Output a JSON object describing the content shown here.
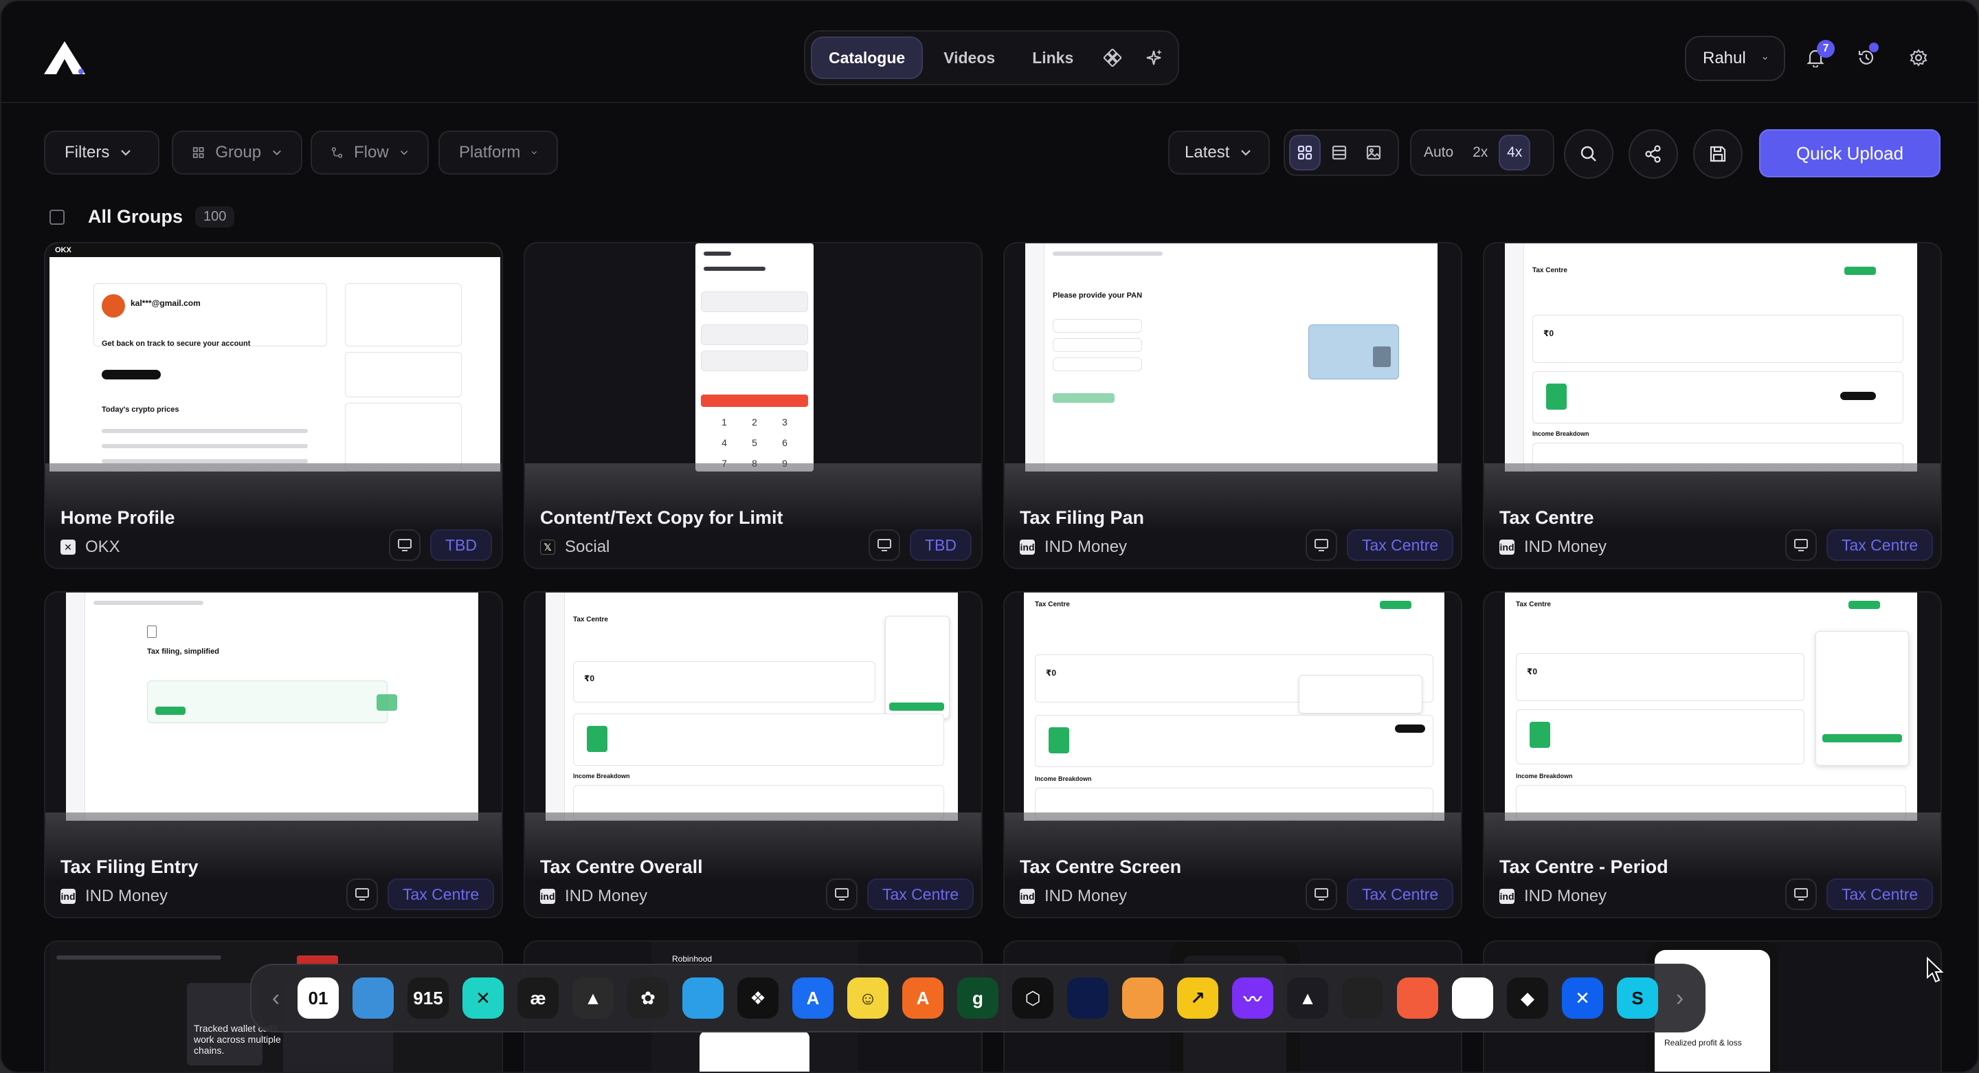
{
  "header": {
    "tabs": [
      {
        "label": "Catalogue",
        "active": true
      },
      {
        "label": "Videos",
        "active": false
      },
      {
        "label": "Links",
        "active": false
      }
    ],
    "user_name": "Rahul",
    "notification_count": "7"
  },
  "toolbar": {
    "filters_label": "Filters",
    "group_label": "Group",
    "flow_label": "Flow",
    "platform_label": "Platform",
    "sort_label": "Latest",
    "scale_options": [
      "Auto",
      "2x",
      "4x"
    ],
    "scale_selected": "4x",
    "quick_upload_label": "Quick Upload"
  },
  "groups": {
    "label": "All Groups",
    "count": "100"
  },
  "cards": [
    {
      "title": "Home Profile",
      "app": "OKX",
      "tag": "TBD"
    },
    {
      "title": "Content/Text Copy for Limit",
      "app": "Social",
      "tag": "TBD"
    },
    {
      "title": "Tax Filing Pan",
      "app": "IND Money",
      "tag": "Tax Centre"
    },
    {
      "title": "Tax Centre",
      "app": "IND Money",
      "tag": "Tax Centre"
    },
    {
      "title": "Tax Filing Entry",
      "app": "IND Money",
      "tag": "Tax Centre"
    },
    {
      "title": "Tax Centre Overall",
      "app": "IND Money",
      "tag": "Tax Centre"
    },
    {
      "title": "Tax Centre Screen",
      "app": "IND Money",
      "tag": "Tax Centre"
    },
    {
      "title": "Tax Centre - Period",
      "app": "IND Money",
      "tag": "Tax Centre"
    }
  ],
  "preview_texts": {
    "okx_email": "kal***@gmail.com",
    "okx_secure": "Get back on track to secure your account",
    "okx_prices": "Today's crypto prices",
    "tax_pan": "Please provide your PAN",
    "tax_simplified": "Tax filing, simplified",
    "tax_centre": "Tax Centre",
    "tax_zero": "₹0",
    "tax_breakdown": "Income Breakdown",
    "tracked_wallets": "Tracked wallet calls work across multiple chains.",
    "realized_pl": "Realized profit & loss",
    "robinhood": "Robinhood"
  },
  "dock": {
    "apps": [
      {
        "icon": "01-app-icon",
        "text": "01",
        "color": "#ffffff"
      },
      {
        "icon": "landscape-app-icon",
        "text": "",
        "color": "#3b8fd9"
      },
      {
        "icon": "915-app-icon",
        "text": "915",
        "color": "#1a1a1a"
      },
      {
        "icon": "x-cross-app-icon",
        "text": "✕",
        "color": "#1ed3c5"
      },
      {
        "icon": "ae-app-icon",
        "text": "æ",
        "color": "#1a1a1a"
      },
      {
        "icon": "triangle-app-icon",
        "text": "▲",
        "color": "#2b2b2b"
      },
      {
        "icon": "ring-app-icon",
        "text": "✿",
        "color": "#222222"
      },
      {
        "icon": "genie-app-icon",
        "text": "",
        "color": "#2c9ee8"
      },
      {
        "icon": "dropbox-app-icon",
        "text": "❖",
        "color": "#111111"
      },
      {
        "icon": "a-blue-app-icon",
        "text": "A",
        "color": "#1a6cf0"
      },
      {
        "icon": "face-app-icon",
        "text": "☺",
        "color": "#f5d33a"
      },
      {
        "icon": "a-orange-app-icon",
        "text": "A",
        "color": "#f26a21"
      },
      {
        "icon": "g-green-app-icon",
        "text": "ɡ",
        "color": "#0e4d2a"
      },
      {
        "icon": "shield-app-icon",
        "text": "⬡",
        "color": "#111111"
      },
      {
        "icon": "lotus-app-icon",
        "text": "",
        "color": "#0d1b4a"
      },
      {
        "icon": "compass-app-icon",
        "text": "",
        "color": "#f29a3d"
      },
      {
        "icon": "arrow-app-icon",
        "text": "↗",
        "color": "#f5c518"
      },
      {
        "icon": "wave-app-icon",
        "text": "〰",
        "color": "#7b2ff7"
      },
      {
        "icon": "mountain-app-icon",
        "text": "▲",
        "color": "#1c1c22"
      },
      {
        "icon": "lock-app-icon",
        "text": "",
        "color": "#222222"
      },
      {
        "icon": "card-app-icon",
        "text": "",
        "color": "#f25c3b"
      },
      {
        "icon": "bolt-app-icon",
        "text": "",
        "color": "#ffffff"
      },
      {
        "icon": "binance-app-icon",
        "text": "◆",
        "color": "#141414"
      },
      {
        "icon": "x-blue-app-icon",
        "text": "✕",
        "color": "#1060f0"
      },
      {
        "icon": "s-cyan-app-icon",
        "text": "S",
        "color": "#13c4e8"
      }
    ]
  }
}
